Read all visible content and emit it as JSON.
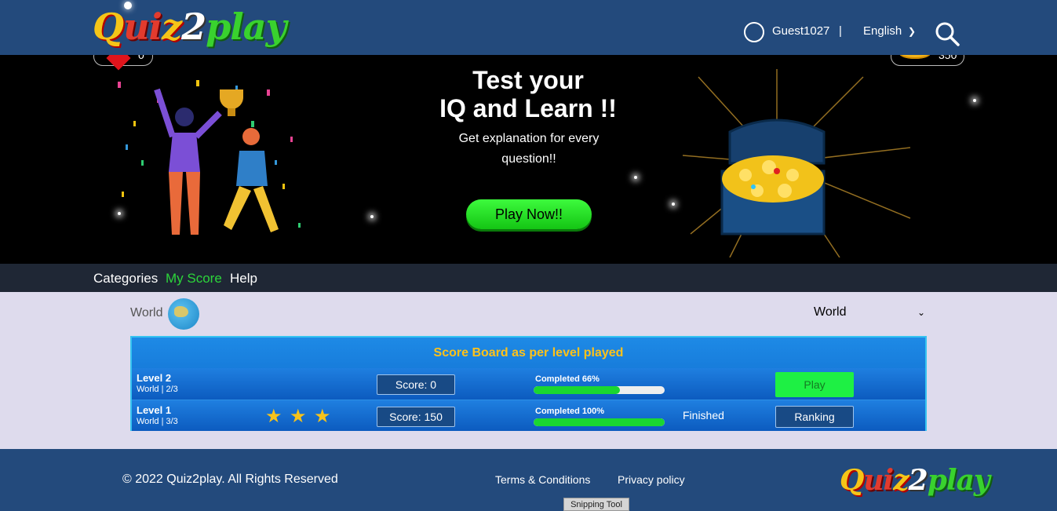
{
  "header": {
    "logo_parts": [
      "Q",
      "ui",
      "z",
      "2",
      "play"
    ],
    "user_name": "Guest1027",
    "separator": "|",
    "language": "English",
    "icons": [
      "user-circle-icon",
      "chevron-down-icon",
      "search-icon"
    ]
  },
  "banner": {
    "hearts_value": "0",
    "coins_value": "350",
    "title_line1": "Test your",
    "title_line2": "IQ and Learn !!",
    "subtitle_line1": "Get explanation for every",
    "subtitle_line2": "question!!",
    "play_now_label": "Play Now!!"
  },
  "subnav": {
    "items": [
      "Categories",
      "My Score",
      "Help"
    ],
    "active_item": "My Score",
    "active_color": "#2cd53a"
  },
  "filter": {
    "label": "World",
    "select_value": "World"
  },
  "scoreboard": {
    "title": "Score Board as per level played",
    "rows": [
      {
        "level": "Level 2",
        "sub": "World | 2/3",
        "stars": 0,
        "score": "Score: 0",
        "completed_label": "Completed 66%",
        "completed_pct": 66,
        "status": "",
        "action": "Play"
      },
      {
        "level": "Level 1",
        "sub": "World | 3/3",
        "stars": 3,
        "score": "Score: 150",
        "completed_label": "Completed 100%",
        "completed_pct": 100,
        "status": "Finished",
        "action": "Ranking"
      }
    ]
  },
  "footer": {
    "copyright": "© 2022 Quiz2play. All Rights Reserved",
    "terms": "Terms & Conditions",
    "privacy": "Privacy policy",
    "logo_parts": [
      "Q",
      "ui",
      "z",
      "2",
      "play"
    ]
  },
  "overlay": {
    "snipping_tool": "Snipping Tool"
  },
  "colors": {
    "header_bg": "#234a7c",
    "banner_bg": "#000000",
    "accent_green": "#1ef044",
    "title_gold": "#ffc21a",
    "page_bg": "#dedbed"
  }
}
